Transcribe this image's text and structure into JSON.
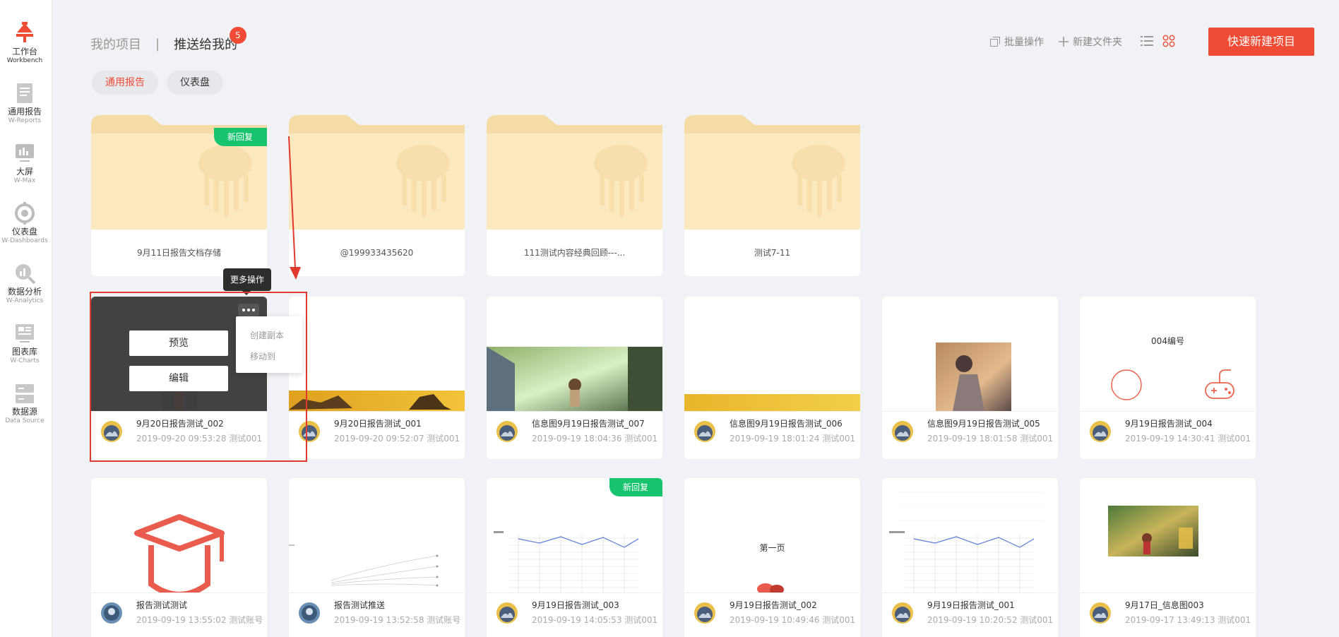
{
  "colors": {
    "accent": "#ef4b35",
    "ribbon": "#18c46e",
    "folder": "#fde9bf",
    "annotation": "#e03a2e"
  },
  "sidebar": {
    "items": [
      {
        "cn": "工作台",
        "en": "Workbench",
        "icon": "workbench-icon"
      },
      {
        "cn": "通用报告",
        "en": "W-Reports",
        "icon": "report-icon"
      },
      {
        "cn": "大屏",
        "en": "W-Max",
        "icon": "screen-icon"
      },
      {
        "cn": "仪表盘",
        "en": "W-Dashboards",
        "icon": "gauge-icon"
      },
      {
        "cn": "数据分析",
        "en": "W-Analytics",
        "icon": "analytics-icon"
      },
      {
        "cn": "图表库",
        "en": "W-Charts",
        "icon": "chart-library-icon"
      },
      {
        "cn": "数据源",
        "en": "Data Source",
        "icon": "datasource-icon"
      }
    ]
  },
  "header": {
    "tab_my": "我的项目",
    "separator": "|",
    "tab_pushed": "推送给我的",
    "badge": "5"
  },
  "filters": [
    {
      "label": "通用报告"
    },
    {
      "label": "仪表盘"
    }
  ],
  "toolbar": {
    "batch": "批量操作",
    "new_folder": "新建文件夹",
    "list_icon": "list-view-icon",
    "grid_icon": "grid-view-icon",
    "cta": "快速新建项目"
  },
  "folders": [
    {
      "name": "9月11日报告文档存储",
      "ribbon": "新回复"
    },
    {
      "name": "@199933435620",
      "ribbon": ""
    },
    {
      "name": "111测试内容经典回顾---...",
      "ribbon": ""
    },
    {
      "name": "测试7-11",
      "ribbon": ""
    }
  ],
  "row1": [
    {
      "title": "9月20日报告测试_002",
      "sub": "2019-09-20 09:53:28 测试001"
    },
    {
      "title": "9月20日报告测试_001",
      "sub": "2019-09-20 09:52:07 测试001"
    },
    {
      "title": "信息图9月19日报告测试_007",
      "sub": "2019-09-19 18:04:36 测试001"
    },
    {
      "title": "信息图9月19日报告测试_006",
      "sub": "2019-09-19 18:01:24 测试001"
    },
    {
      "title": "信息图9月19日报告测试_005",
      "sub": "2019-09-19 18:01:58 测试001"
    },
    {
      "title": "9月19日报告测试_004",
      "sub": "2019-09-19 14:30:41 测试001",
      "thumb_text": "004编号"
    }
  ],
  "row2": [
    {
      "title": "报告测试测试",
      "sub": "2019-09-19 13:55:02 测试账号"
    },
    {
      "title": "报告测试推送",
      "sub": "2019-09-19 13:52:58 测试账号"
    },
    {
      "title": "9月19日报告测试_003",
      "sub": "2019-09-19 14:05:53 测试001",
      "ribbon": "新回复"
    },
    {
      "title": "9月19日报告测试_002",
      "sub": "2019-09-19 10:49:46 测试001",
      "thumb_text": "第一页"
    },
    {
      "title": "9月19日报告测试_001",
      "sub": "2019-09-19 10:20:52 测试001"
    },
    {
      "title": "9月17日_信息图003",
      "sub": "2019-09-17 13:49:13 测试001"
    }
  ],
  "hover": {
    "preview": "预览",
    "edit": "编辑",
    "tooltip": "更多操作",
    "menu": [
      "创建副本",
      "移动到"
    ]
  }
}
